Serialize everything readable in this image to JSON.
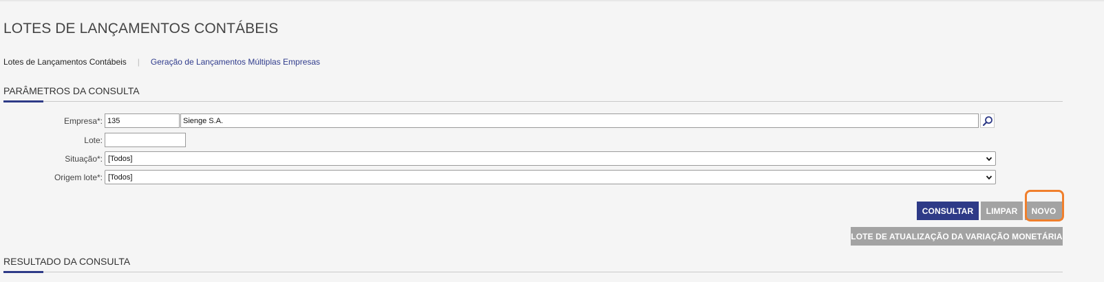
{
  "page": {
    "title": "LOTES DE LANÇAMENTOS CONTÁBEIS"
  },
  "subnav": {
    "active": "Lotes de Lançamentos Contábeis",
    "separator": "|",
    "link": "Geração de Lançamentos Múltiplas Empresas"
  },
  "params_section": {
    "title": "PARÂMETROS DA CONSULTA"
  },
  "form": {
    "empresa": {
      "label": "Empresa*:",
      "code": "135",
      "name": "Sienge S.A."
    },
    "lote": {
      "label": "Lote:",
      "value": ""
    },
    "situacao": {
      "label": "Situação*:",
      "selected": "[Todos]"
    },
    "origem": {
      "label": "Origem lote*:",
      "selected": "[Todos]"
    }
  },
  "actions": {
    "consultar": "CONSULTAR",
    "limpar": "LIMPAR",
    "novo": "NOVO",
    "lote_atualizacao": "LOTE DE ATUALIZAÇÃO DA VARIAÇÃO MONETÁRIA"
  },
  "result_section": {
    "title": "RESULTADO DA CONSULTA"
  },
  "colors": {
    "primary": "#2e3a87",
    "gray_button": "#a3a3a3",
    "highlight": "#f07f2c",
    "background": "#f5f5f5"
  }
}
